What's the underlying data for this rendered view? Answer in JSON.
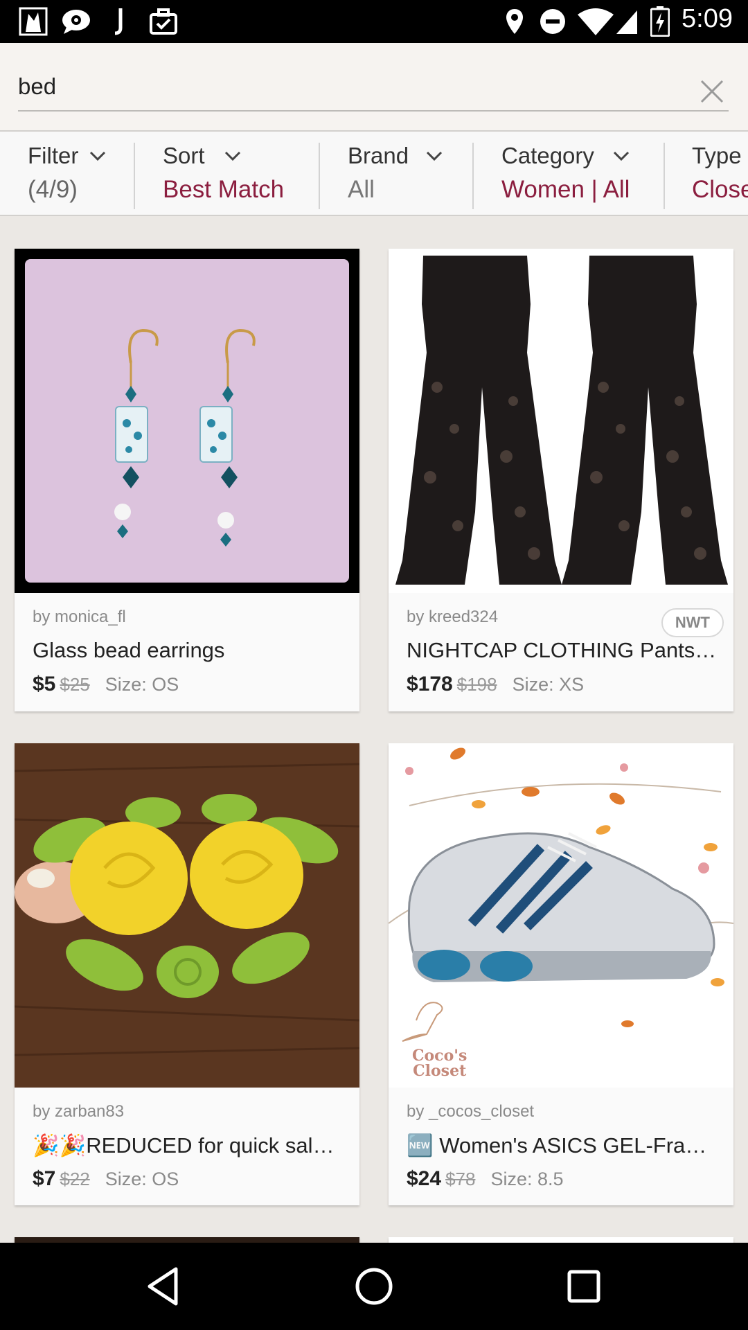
{
  "status_bar": {
    "time": "5:09",
    "icons": [
      "app-icon",
      "chat-icon",
      "j-icon",
      "briefcase-check-icon",
      "location-icon",
      "do-not-disturb-icon",
      "wifi-icon",
      "signal-icon",
      "battery-charging-icon"
    ]
  },
  "search": {
    "query": "bed"
  },
  "filters": [
    {
      "label": "Filter",
      "value": "(4/9)",
      "value_color": "#666666"
    },
    {
      "label": "Sort",
      "value": "Best Match",
      "value_color": "#8b1e3f"
    },
    {
      "label": "Brand",
      "value": "All",
      "value_color": "#777777"
    },
    {
      "label": "Category",
      "value": "Women | All",
      "value_color": "#8b1e3f"
    },
    {
      "label": "Type",
      "value": "Closet",
      "value_color": "#8b1e3f"
    }
  ],
  "listings": [
    {
      "seller": "by monica_fl",
      "title": "Glass bead earrings",
      "price": "$5",
      "original_price": "$25",
      "size": "Size: OS",
      "badge": ""
    },
    {
      "seller": "by kreed324",
      "title": "NIGHTCAP CLOTHING Pants Lace Bell Bottoms",
      "price": "$178",
      "original_price": "$198",
      "size": "Size: XS",
      "badge": "NWT"
    },
    {
      "seller": "by zarban83",
      "title": "🎉🎉REDUCED for quick sale Vintage Yellow Rose Brooch",
      "price": "$7",
      "original_price": "$22",
      "size": "Size: OS",
      "badge": ""
    },
    {
      "seller": "by _cocos_closet",
      "title": "🆕 Women's ASICS GEL-Frantic Running Shoes",
      "price": "$24",
      "original_price": "$78",
      "size": "Size: 8.5",
      "badge": ""
    }
  ],
  "image_texts": {
    "cocos_logo_line1": "Coco's",
    "cocos_logo_line2": "Closet"
  },
  "colors": {
    "accent": "#8b1e3f",
    "background": "#ebe8e4"
  }
}
